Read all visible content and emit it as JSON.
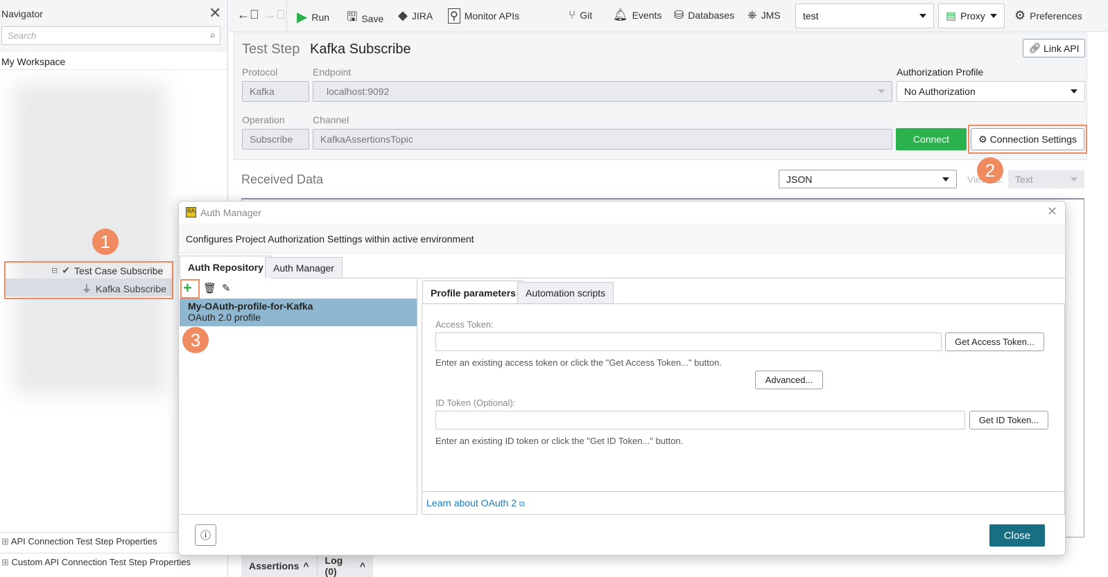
{
  "navigator": {
    "title": "Navigator",
    "search_placeholder": "Search",
    "workspace": "My Workspace",
    "tree": [
      {
        "label": "Test Case Subscribe"
      },
      {
        "label": "Kafka Subscribe"
      }
    ],
    "bottom_sections": [
      "API Connection Test Step Properties",
      "Custom API Connection Test Step Properties"
    ]
  },
  "toolbar": {
    "run": "Run",
    "save": "Save",
    "jira": "JIRA",
    "monitor": "Monitor APIs",
    "git": "Git",
    "events": "Events",
    "databases": "Databases",
    "jms": "JMS",
    "environment": "test",
    "proxy": "Proxy",
    "preferences": "Preferences"
  },
  "step": {
    "prefix": "Test Step",
    "name": "Kafka Subscribe",
    "link_api": "Link API",
    "protocol_label": "Protocol",
    "protocol": "Kafka",
    "endpoint_label": "Endpoint",
    "endpoint": "localhost:9092",
    "auth_label": "Authorization Profile",
    "auth": "No Authorization",
    "operation_label": "Operation",
    "operation": "Subscribe",
    "channel_label": "Channel",
    "channel": "KafkaAssertionsTopic",
    "connect": "Connect",
    "connection_settings": "Connection Settings"
  },
  "received": {
    "title": "Received Data",
    "format": "JSON",
    "view_label": "View as:",
    "view": "Text"
  },
  "bottom_tabs": [
    "Assertions",
    "Log (0)"
  ],
  "dialog": {
    "title": "Auth Manager",
    "description": "Configures Project Authorization Settings within active environment",
    "tabs": [
      "Auth Repository",
      "Auth Manager"
    ],
    "profiles": [
      {
        "name": "My-OAuth-profile-for-Kafka",
        "type": "OAuth 2.0 profile"
      }
    ],
    "inner_tabs": [
      "Profile parameters",
      "Automation scripts"
    ],
    "access_token_label": "Access Token:",
    "access_token": "",
    "get_access_token": "Get Access Token...",
    "access_hint": "Enter an existing access token or click the \"Get Access Token...\" button.",
    "advanced": "Advanced...",
    "id_token_label": "ID Token (Optional):",
    "id_token": "",
    "get_id_token": "Get ID Token...",
    "id_hint": "Enter an existing ID token or click the \"Get ID Token...\" button.",
    "learn_link": "Learn about OAuth 2",
    "close": "Close"
  },
  "callouts": [
    "1",
    "2",
    "3"
  ],
  "colors": {
    "accent_green": "#2bb24c",
    "callout": "#f08a60",
    "selection": "#8fb7d0",
    "close_button": "#186f84",
    "link": "#1a7dbf"
  }
}
